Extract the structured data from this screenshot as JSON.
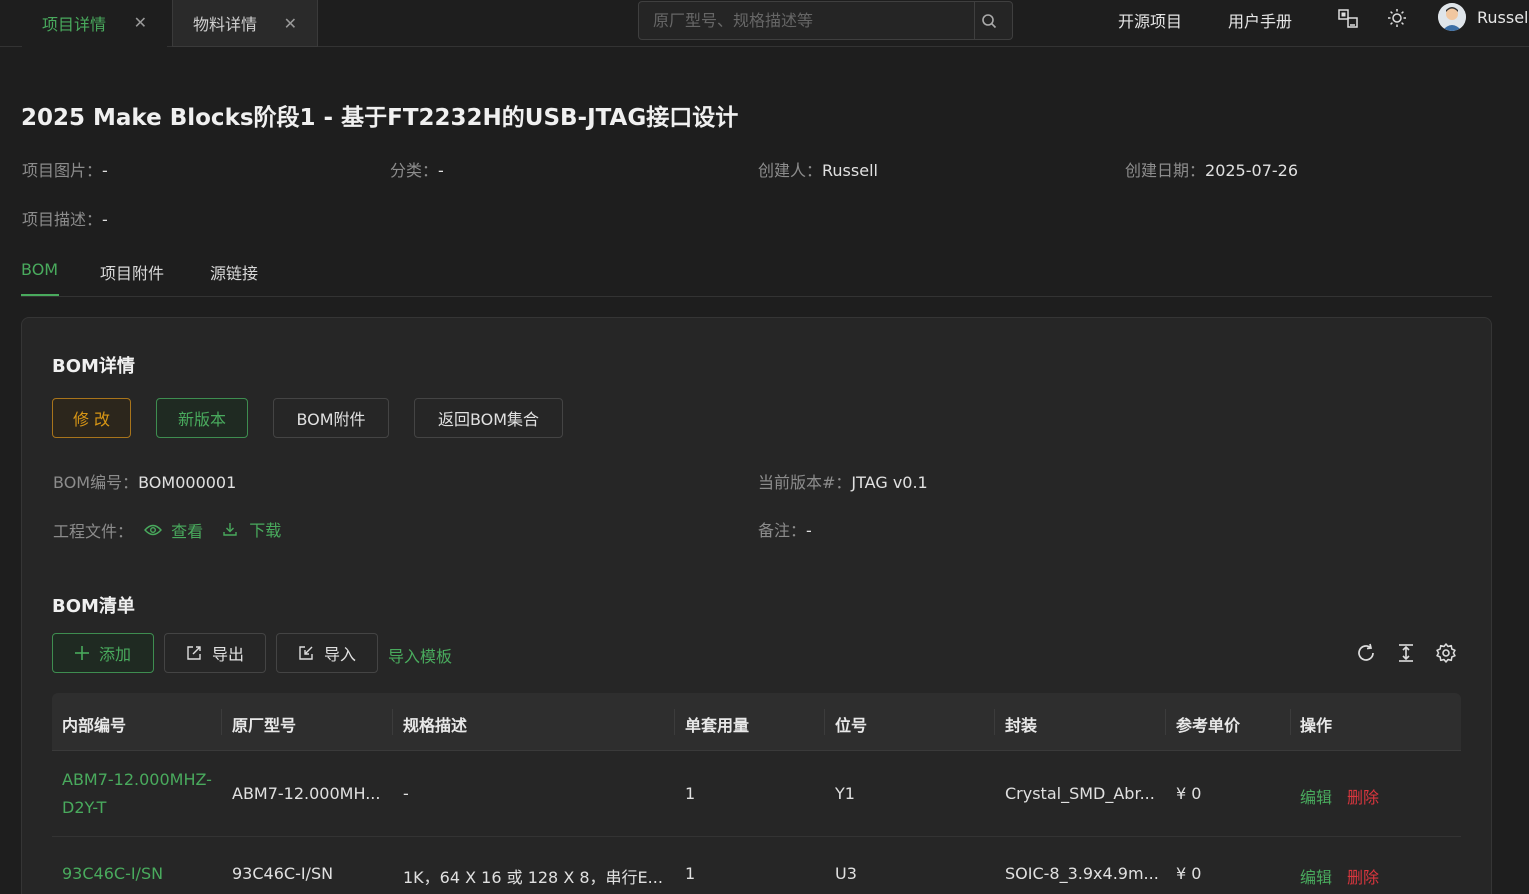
{
  "tabs": [
    {
      "label": "项目详情",
      "active": true
    },
    {
      "label": "物料详情",
      "active": false
    }
  ],
  "search": {
    "placeholder": "原厂型号、规格描述等"
  },
  "nav": {
    "open_source": "开源项目",
    "manual": "用户手册",
    "username": "Russell"
  },
  "icons": {
    "tab_close": "close-icon",
    "search": "search-icon",
    "translate": "translate-icon",
    "theme": "sun-icon",
    "view": "eye-icon",
    "download": "download-icon",
    "add": "plus-icon",
    "export": "export-icon",
    "import": "import-icon",
    "refresh": "refresh-icon",
    "density": "column-height-icon",
    "settings": "gear-icon"
  },
  "project": {
    "title": "2025 Make Blocks阶段1 - 基于FT2232H的USB-JTAG接口设计",
    "image_label": "项目图片：",
    "image_value": "-",
    "category_label": "分类：",
    "category_value": "-",
    "creator_label": "创建人：",
    "creator_value": "Russell",
    "date_label": "创建日期：",
    "date_value": "2025-07-26",
    "desc_label": "项目描述：",
    "desc_value": "-"
  },
  "section_tabs": [
    {
      "label": "BOM",
      "active": true
    },
    {
      "label": "项目附件",
      "active": false
    },
    {
      "label": "源链接",
      "active": false
    }
  ],
  "bom": {
    "title": "BOM详情",
    "buttons": {
      "edit": "修 改",
      "new_version": "新版本",
      "attachments": "BOM附件",
      "back": "返回BOM集合"
    },
    "number_label": "BOM编号：",
    "number_value": "BOM000001",
    "version_label": "当前版本#：",
    "version_value": "JTAG v0.1",
    "files_label": "工程文件：",
    "view": "查看",
    "download": "下载",
    "remark_label": "备注：",
    "remark_value": "-"
  },
  "bom_list": {
    "title": "BOM清单",
    "add": "添加",
    "export": "导出",
    "import": "导入",
    "template": "导入模板",
    "columns": [
      "内部编号",
      "原厂型号",
      "规格描述",
      "单套用量",
      "位号",
      "封装",
      "参考单价",
      "操作"
    ],
    "rows": [
      {
        "internal": "ABM7-12.000MHZ-D2Y-T",
        "mpn": "ABM7-12.000MH...",
        "spec": "-",
        "qty": "1",
        "ref": "Y1",
        "package": "Crystal_SMD_Abr...",
        "price": "¥ 0",
        "edit": "编辑",
        "delete": "删除"
      },
      {
        "internal": "93C46C-I/SN",
        "mpn": "93C46C-I/SN",
        "spec": "1K，64 X 16 或 128 X 8，串行E...",
        "qty": "1",
        "ref": "U3",
        "package": "SOIC-8_3.9x4.9m...",
        "price": "¥ 0",
        "edit": "编辑",
        "delete": "删除"
      }
    ]
  }
}
